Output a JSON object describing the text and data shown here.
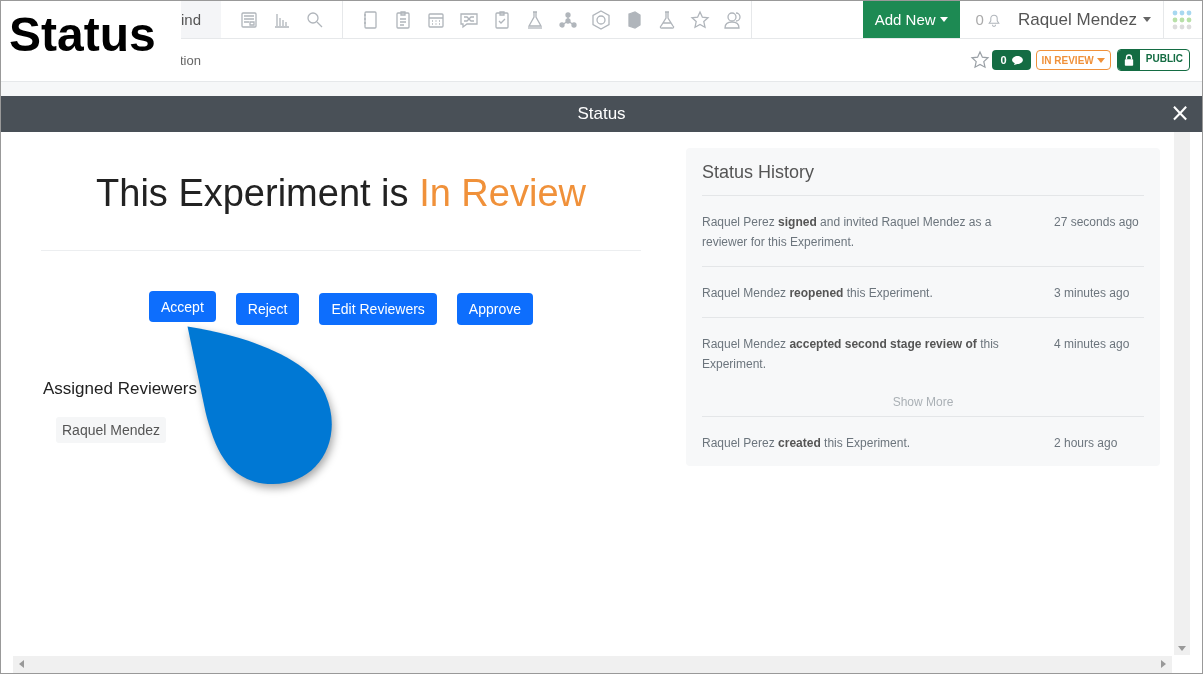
{
  "overlay_title": "Status",
  "nav": {
    "search_value": "ind",
    "add_new": "Add New",
    "notifications_count": "0",
    "user": "Raquel Mendez"
  },
  "subheader": {
    "breadcrumb": "tion",
    "comments_count": "0",
    "status": "IN REVIEW",
    "visibility": "PUBLIC"
  },
  "modal": {
    "title": "Status",
    "close": "×",
    "heading": "This Experiment is",
    "status_text": "In Review",
    "actions": [
      {
        "label": "Accept"
      },
      {
        "label": "Reject"
      },
      {
        "label": "Edit Reviewers"
      },
      {
        "label": "Approve"
      }
    ],
    "reviewers_title": "Assigned Reviewers",
    "reviewers": [
      "Raquel Mendez"
    ]
  },
  "history": {
    "title": "Status History",
    "items": [
      {
        "kind": "entry",
        "text": "Raquel Perez **signed** and invited Raquel Mendez as a reviewer for this Experiment.",
        "time": "27 seconds ago"
      },
      {
        "kind": "entry",
        "text": "Raquel Mendez **reopened** this Experiment.",
        "time": "3 minutes ago"
      },
      {
        "kind": "entry",
        "text": "Raquel Mendez **accepted second stage review of** this Experiment.",
        "time": "4 minutes ago"
      },
      {
        "kind": "more",
        "text": "Show More"
      },
      {
        "kind": "entry",
        "text": "Raquel Perez **created** this Experiment.",
        "time": "2 hours ago"
      }
    ]
  }
}
